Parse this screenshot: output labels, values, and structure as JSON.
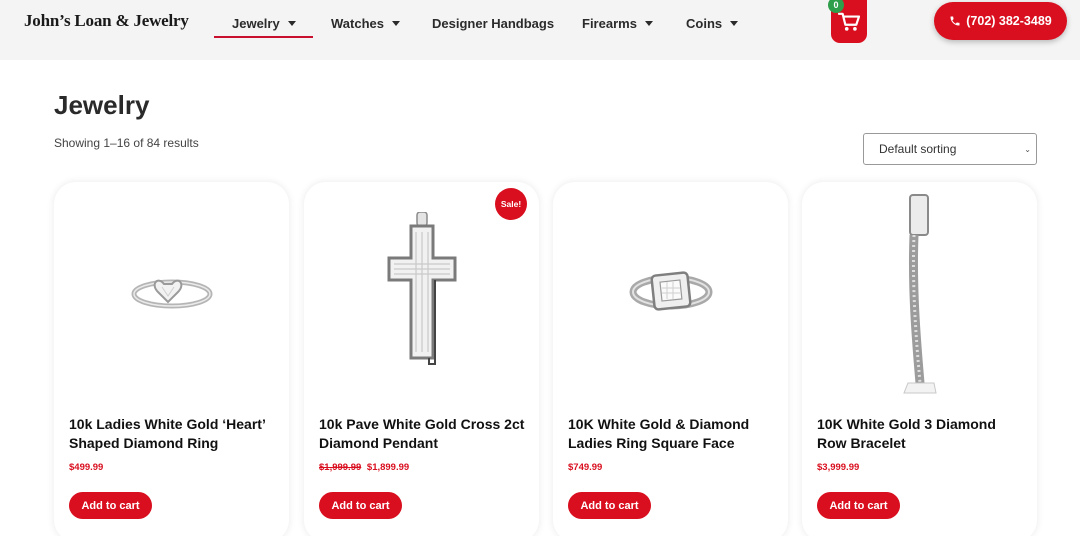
{
  "header": {
    "logo": "John’s Loan & Jewelry",
    "nav": [
      {
        "label": "Jewelry",
        "has_dropdown": true,
        "active": true
      },
      {
        "label": "Watches",
        "has_dropdown": true
      },
      {
        "label": "Designer Handbags",
        "has_dropdown": false
      },
      {
        "label": "Firearms",
        "has_dropdown": true
      },
      {
        "label": "Coins",
        "has_dropdown": true
      }
    ],
    "cart": {
      "icon": "cart-icon",
      "count": "0"
    },
    "phone": {
      "icon": "phone-icon",
      "label": "(702) 382-3489"
    }
  },
  "page": {
    "title": "Jewelry",
    "result_count": "Showing 1–16 of 84 results",
    "sorting": {
      "selected": "Default sorting"
    }
  },
  "products": [
    {
      "name": "10k Ladies White Gold ‘Heart’ Shaped Diamond Ring",
      "price": "$499.99",
      "old_price": "",
      "on_sale": false,
      "add_label": "Add to cart"
    },
    {
      "name": "10k Pave White Gold Cross 2ct Diamond Pendant",
      "price": "$1,899.99",
      "old_price": "$1,999.99",
      "on_sale": true,
      "sale_label": "Sale!",
      "add_label": "Add to cart"
    },
    {
      "name": "10K White Gold & Diamond Ladies Ring Square Face",
      "price": "$749.99",
      "old_price": "",
      "on_sale": false,
      "add_label": "Add to cart"
    },
    {
      "name": "10K White Gold 3 Diamond Row Bracelet",
      "price": "$3,999.99",
      "old_price": "",
      "on_sale": false,
      "add_label": "Add to cart"
    }
  ],
  "colors": {
    "accent": "#d90f1f",
    "cart_badge": "#2e9e4b",
    "nav_underline": "#c8102e"
  }
}
